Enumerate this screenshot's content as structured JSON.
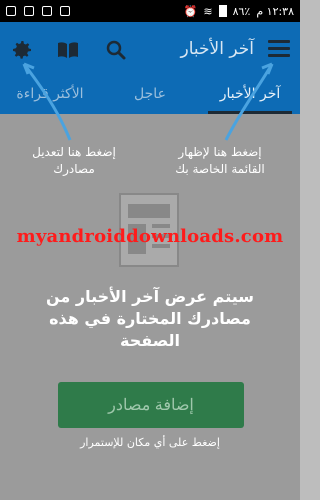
{
  "status_bar": {
    "battery": "٨٦٪",
    "time": "١٢:٣٨ م"
  },
  "app_bar": {
    "title": "آخر الأخبار"
  },
  "tabs": [
    {
      "label": "آخر الأخبار",
      "active": true
    },
    {
      "label": "عاجل",
      "active": false
    },
    {
      "label": "الأكثر قراءة",
      "active": false
    }
  ],
  "hints": {
    "menu_hint": "إضغط هنا لإظهار القائمة الخاصة بك",
    "settings_hint": "إضغط هنا لتعديل مصادرك"
  },
  "watermark": "myandroiddownloads.com",
  "empty_message": "سيتم عرض آخر الأخبار من مصادرك المختارة في هذه الصفحة",
  "add_sources_button": "إضافة مصادر",
  "continue_note": "إضغط على أي مكان للإستمرار",
  "colors": {
    "primary": "#0d6bb5",
    "button_green": "#2f7b4a",
    "watermark_red": "#ff1b1b"
  }
}
